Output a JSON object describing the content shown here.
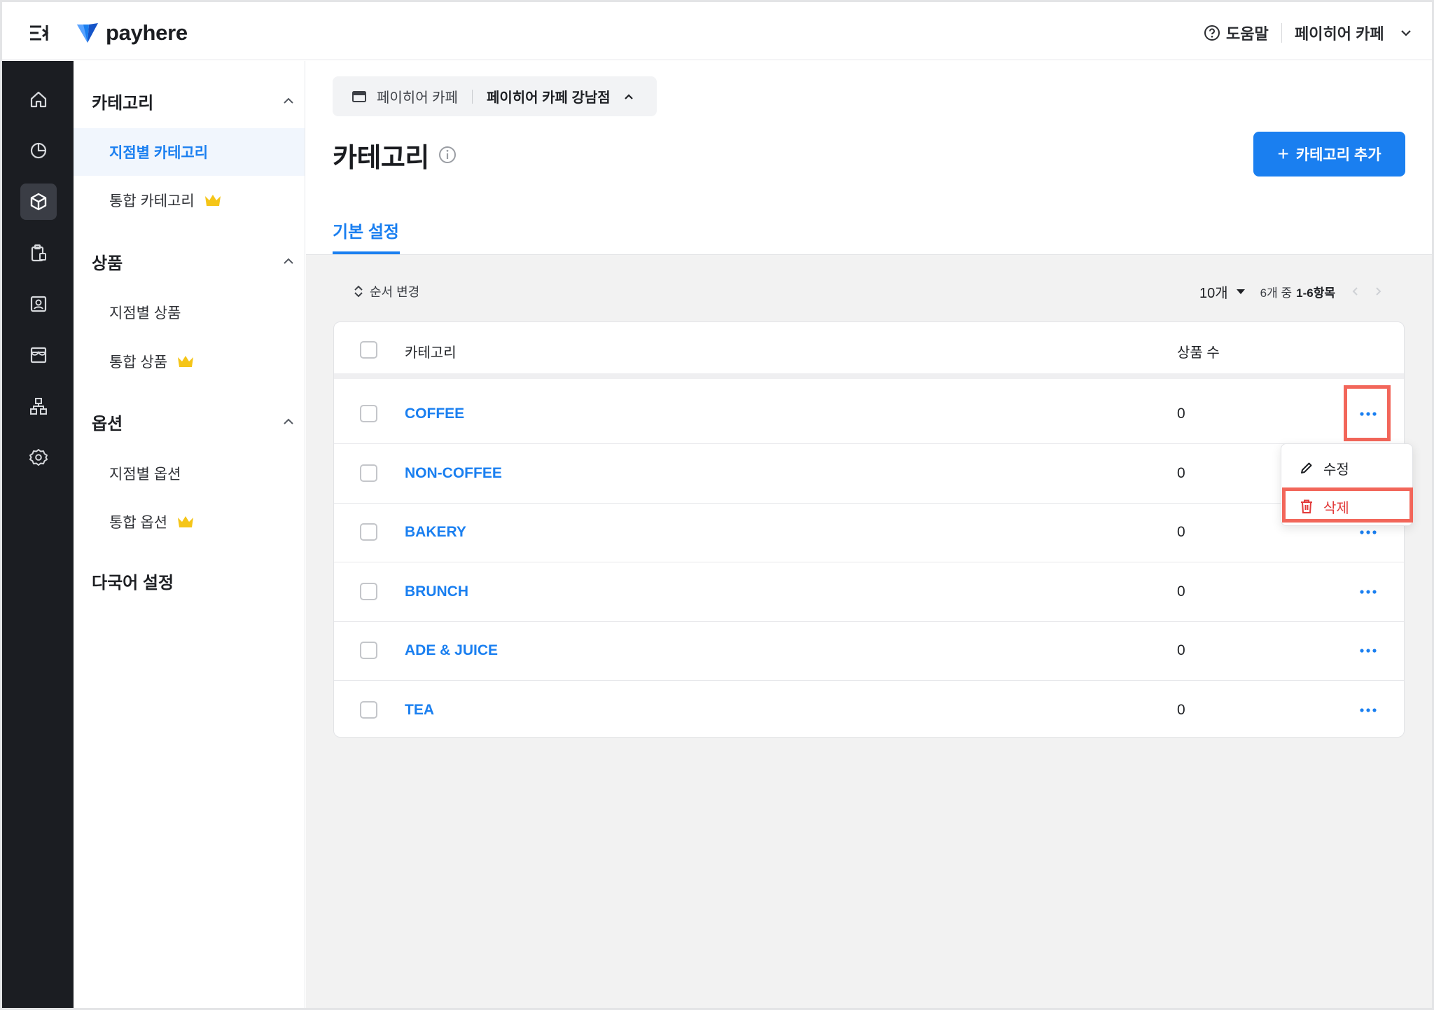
{
  "brand": {
    "name": "payhere",
    "logo_blue": "#1a7ff0"
  },
  "topbar": {
    "help_label": "도움말",
    "store_label": "페이히어 카페"
  },
  "rail": {
    "icons": [
      "home-icon",
      "chart-icon",
      "box-icon",
      "clipboard-icon",
      "user-card-icon",
      "store-icon",
      "org-chart-icon",
      "settings-icon"
    ],
    "active": "box-icon"
  },
  "subnav": {
    "sections": [
      {
        "title": "카테고리",
        "items": [
          "지점별 카테고리",
          "통합 카테고리"
        ]
      },
      {
        "title": "상품",
        "items": [
          "지점별 상품",
          "통합 상품"
        ]
      },
      {
        "title": "옵션",
        "items": [
          "지점별 옵션",
          "통합 옵션"
        ]
      }
    ],
    "language": "다국어 설정",
    "active_item": "지점별 카테고리"
  },
  "branch": {
    "brand": "페이히어 카페",
    "branch": "페이히어 카페 강남점"
  },
  "page": {
    "title": "카테고리",
    "add_button": "카테고리 추가",
    "tab": "기본 설정"
  },
  "toolbar": {
    "reorder": "순서 변경",
    "page_size": "10개",
    "range_prefix": "6개 중",
    "range": "1-6항목"
  },
  "table": {
    "headers": {
      "name": "카테고리",
      "count": "상품 수"
    },
    "rows": [
      {
        "name": "COFFEE",
        "count": "0"
      },
      {
        "name": "NON-COFFEE",
        "count": "0"
      },
      {
        "name": "BAKERY",
        "count": "0"
      },
      {
        "name": "BRUNCH",
        "count": "0"
      },
      {
        "name": "ADE & JUICE",
        "count": "0"
      },
      {
        "name": "TEA",
        "count": "0"
      }
    ]
  },
  "context_menu": {
    "edit": "수정",
    "delete": "삭제"
  },
  "colors": {
    "accent": "#1a7ff0",
    "highlight": "#f2665a",
    "danger": "#e23b3b",
    "rail": "#1b1d22",
    "crown": "#f5c518"
  }
}
